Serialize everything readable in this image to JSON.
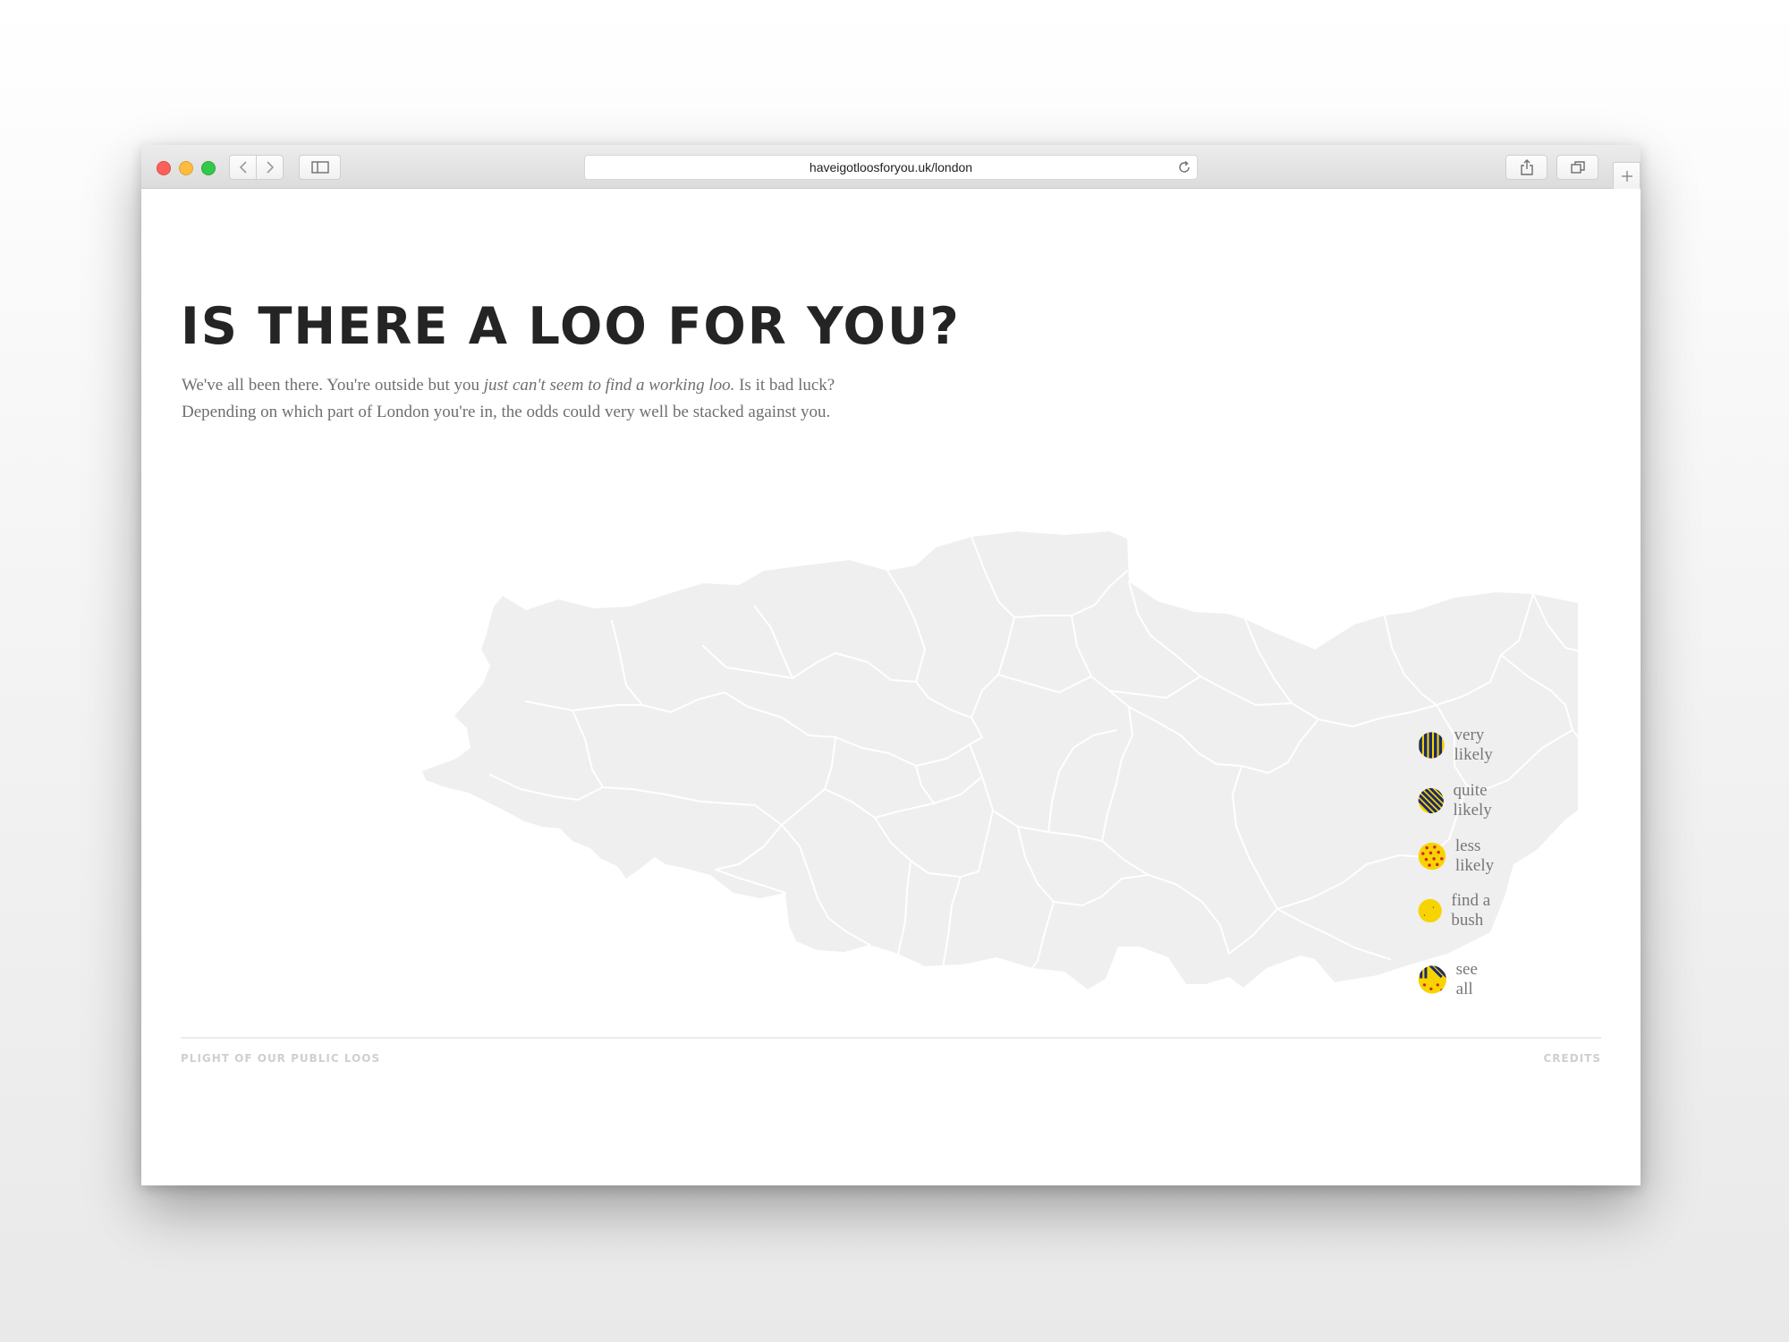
{
  "browser": {
    "url": "haveigotloosforyou.uk/london"
  },
  "page": {
    "headline": "IS THERE A LOO FOR YOU?",
    "intro_part1": "We've all been there. You're outside but you ",
    "intro_emphasis": "just can't seem to find a working loo.",
    "intro_part2": " Is it bad luck?",
    "intro_line2": "Depending on which part of London you're in, the odds could very well be stacked against you."
  },
  "map": {
    "region": "London",
    "fill_color": "#efefef",
    "border_color": "#ffffff"
  },
  "legend": {
    "items": [
      {
        "label": "very likely",
        "pattern": "vertical-stripes",
        "colors": [
          "#1c2a6e",
          "#f7d400"
        ]
      },
      {
        "label": "quite likely",
        "pattern": "diagonal-stripes",
        "colors": [
          "#1c2a6e",
          "#f7d400"
        ]
      },
      {
        "label": "less likely",
        "pattern": "red-dots",
        "colors": [
          "#f7d400",
          "#d1262e"
        ]
      },
      {
        "label": "find a bush",
        "pattern": "plain-yellow",
        "colors": [
          "#f7d400"
        ]
      }
    ],
    "see_all": "see all"
  },
  "footer": {
    "left": "PLIGHT OF OUR PUBLIC LOOS",
    "right": "CREDITS"
  }
}
